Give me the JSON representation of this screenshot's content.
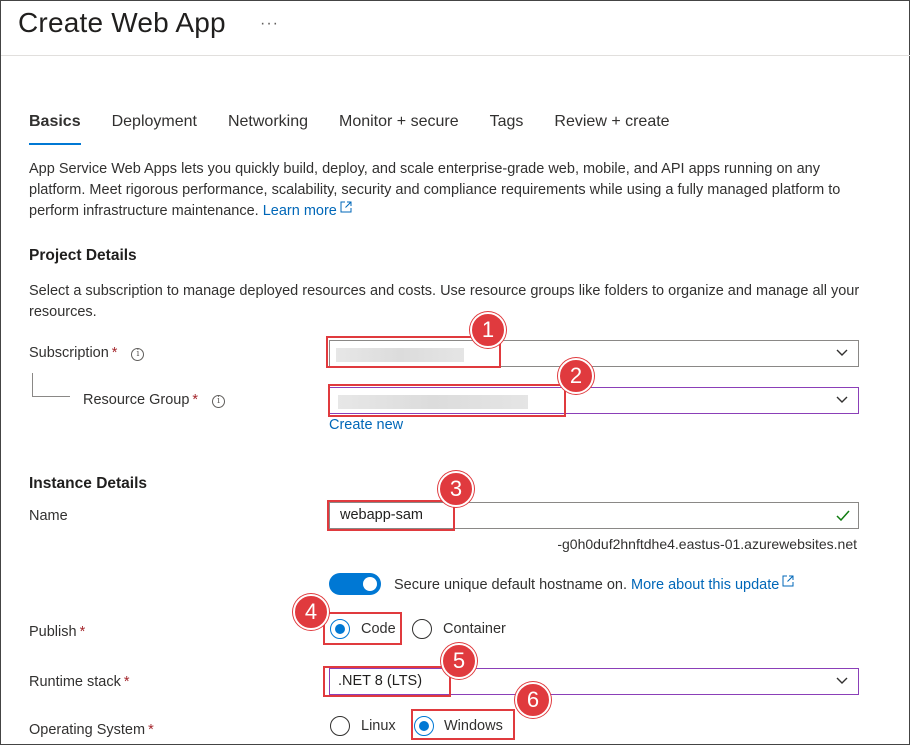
{
  "page": {
    "title": "Create Web App",
    "more_label": "···"
  },
  "tabs": [
    {
      "label": "Basics"
    },
    {
      "label": "Deployment"
    },
    {
      "label": "Networking"
    },
    {
      "label": "Monitor + secure"
    },
    {
      "label": "Tags"
    },
    {
      "label": "Review + create"
    }
  ],
  "description": {
    "text": "App Service Web Apps lets you quickly build, deploy, and scale enterprise-grade web, mobile, and API apps running on any platform. Meet rigorous performance, scalability, security and compliance requirements while using a fully managed platform to perform infrastructure maintenance.",
    "learn_more": "Learn more"
  },
  "project": {
    "heading": "Project Details",
    "text": "Select a subscription to manage deployed resources and costs. Use resource groups like folders to organize and manage all your resources.",
    "subscription_label": "Subscription",
    "resource_group_label": "Resource Group",
    "create_new": "Create new"
  },
  "instance": {
    "heading": "Instance Details",
    "name_label": "Name",
    "name_value": "webapp-sam",
    "hostname_suffix": "-g0h0duf2hnftdhe4.eastus-01.azurewebsites.net",
    "secure_hostname_text": "Secure unique default hostname on.",
    "more_about": "More about this update",
    "secure_hostname_on": true,
    "publish_label": "Publish",
    "publish_options": [
      "Code",
      "Container"
    ],
    "publish_selected": "Code",
    "runtime_label": "Runtime stack",
    "runtime_value": ".NET 8 (LTS)",
    "os_label": "Operating System",
    "os_options": [
      "Linux",
      "Windows"
    ],
    "os_selected": "Windows"
  },
  "required_mark": "*",
  "callouts": [
    "1",
    "2",
    "3",
    "4",
    "5",
    "6"
  ],
  "colors": {
    "accent": "#0078d4",
    "link": "#0067b8",
    "required": "#a4262c",
    "callout": "#e03a3e",
    "valid_check": "#107c10"
  }
}
